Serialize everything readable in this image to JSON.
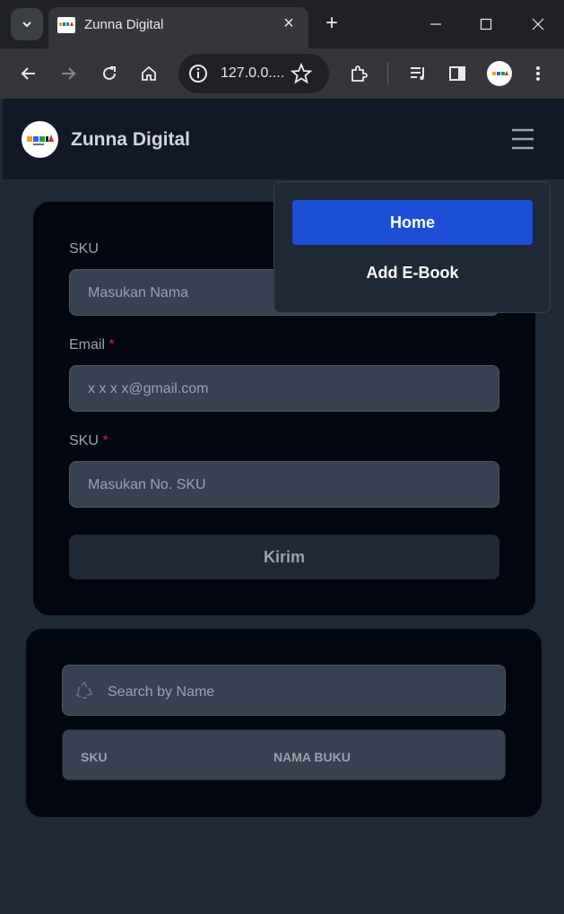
{
  "browser": {
    "tab_title": "Zunna Digital",
    "address": "127.0.0....",
    "new_tab_symbol": "+",
    "close_symbol": "×"
  },
  "navbar": {
    "brand": "Zunna Digital",
    "menu_icon": "hamburger-icon"
  },
  "form": {
    "fields": [
      {
        "label": "SKU",
        "required": false,
        "placeholder": "Masukan Nama"
      },
      {
        "label": "Email",
        "required": true,
        "placeholder": "x x x x@gmail.com"
      },
      {
        "label": "SKU",
        "required": true,
        "placeholder": "Masukan No. SKU"
      }
    ],
    "required_mark": "*",
    "submit_label": "Kirim"
  },
  "table": {
    "search_placeholder": "Search by Name",
    "search_icon": "recycle-icon",
    "columns": [
      "SKU",
      "NAMA BUKU"
    ]
  },
  "dropdown": {
    "items": [
      {
        "label": "Home",
        "active": true
      },
      {
        "label": "Add E-Book",
        "active": false
      }
    ]
  },
  "colors": {
    "primary": "#1d4ed8",
    "navbar": "#111827",
    "card": "#030712",
    "input": "#374151",
    "required": "#dc2626"
  }
}
